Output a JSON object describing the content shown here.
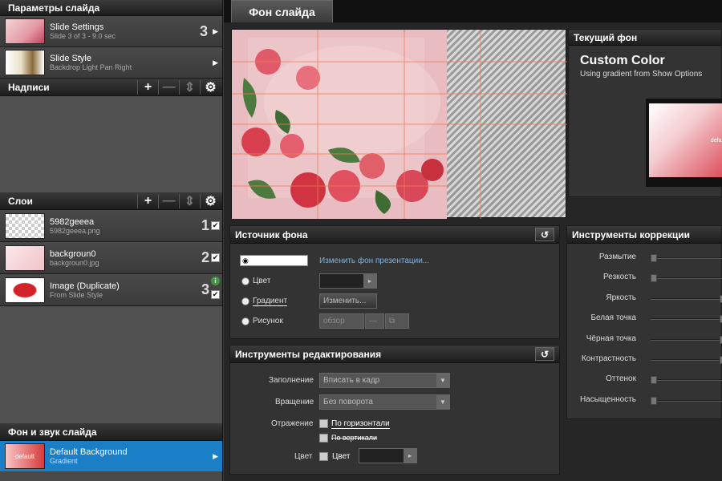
{
  "slide_params": {
    "header": "Параметры слайда",
    "settings": {
      "title": "Slide Settings",
      "sub": "Slide 3 of 3 - 9.0 sec",
      "num": "3"
    },
    "style": {
      "title": "Slide Style",
      "sub": "Backdrop Light Pan Right"
    }
  },
  "captions": {
    "header": "Надписи"
  },
  "layers": {
    "header": "Слои",
    "items": [
      {
        "title": "5982geeea",
        "sub": "5982geeea.png",
        "num": "1"
      },
      {
        "title": "backgroun0",
        "sub": "backgroun0.jpg",
        "num": "2"
      },
      {
        "title": "Image (Duplicate)",
        "sub": "From Slide Style",
        "num": "3"
      }
    ]
  },
  "bg_sound": {
    "header": "Фон и звук слайда",
    "item": {
      "title": "Default Background",
      "sub": "Gradient",
      "thumb_label": "default"
    }
  },
  "tab": {
    "label": "Фон слайда"
  },
  "current_bg": {
    "header": "Текущий фон",
    "title": "Custom Color",
    "sub": "Using gradient from Show Options",
    "swatch_label": "defaul"
  },
  "source": {
    "header": "Источник фона",
    "change_link": "Изменить фон презентации...",
    "color_label": "Цвет",
    "gradient_label": "Градиент",
    "gradient_btn": "Изменить...",
    "picture_label": "Рисунок",
    "browse_btn": "обзор"
  },
  "edit_tools": {
    "header": "Инструменты редактирования",
    "fill_label": "Заполнение",
    "fill_value": "Вписать в кадр",
    "rotate_label": "Вращение",
    "rotate_value": "Без поворота",
    "mirror_label": "Отражение",
    "mirror_h": "По горизонтали",
    "mirror_v": "По вертикали",
    "color_label": "Цвет",
    "color_check": "Цвет"
  },
  "correction": {
    "header": "Инструменты коррекции",
    "sliders": [
      {
        "label": "Размытие",
        "value": 0
      },
      {
        "label": "Резкость",
        "value": 0
      },
      {
        "label": "Яркость",
        "value": 1
      },
      {
        "label": "Белая точка",
        "value": 1
      },
      {
        "label": "Чёрная точка",
        "value": 1
      },
      {
        "label": "Контрастность",
        "value": 1
      },
      {
        "label": "Оттенок",
        "value": 0
      },
      {
        "label": "Насыщенность",
        "value": 0
      }
    ]
  },
  "colors": {
    "accent": "#1a7fc6",
    "dark": "#1d1d1d",
    "panel": "#333333"
  }
}
